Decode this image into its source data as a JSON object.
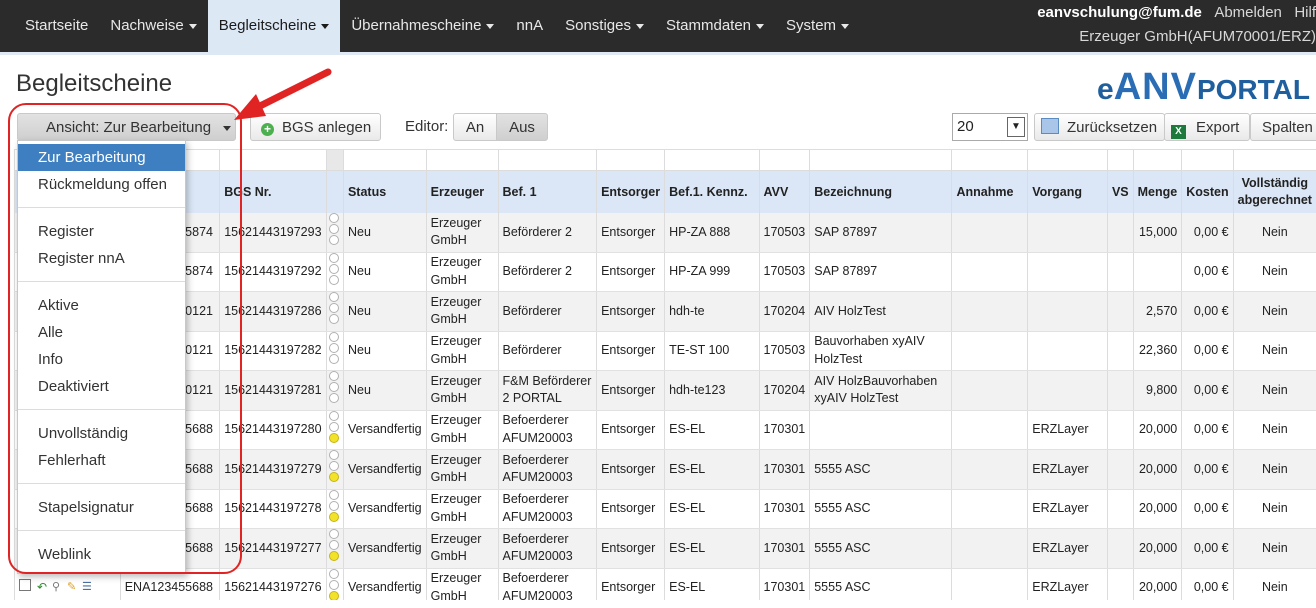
{
  "nav": {
    "items": [
      {
        "label": "Startseite",
        "caret": false,
        "active": false
      },
      {
        "label": "Nachweise",
        "caret": true,
        "active": false
      },
      {
        "label": "Begleitscheine",
        "caret": true,
        "active": true
      },
      {
        "label": "Übernahmescheine",
        "caret": true,
        "active": false
      },
      {
        "label": "nnA",
        "caret": false,
        "active": false
      },
      {
        "label": "Sonstiges",
        "caret": true,
        "active": false
      },
      {
        "label": "Stammdaten",
        "caret": true,
        "active": false
      },
      {
        "label": "System",
        "caret": true,
        "active": false
      }
    ],
    "user": "eanvschulung@fum.de",
    "logout": "Abmelden",
    "help": "Hilf",
    "company": "Erzeuger GmbH(AFUM70001/ERZ)"
  },
  "page": {
    "title": "Begleitscheine",
    "logo_e": "e",
    "logo_anv": "ANV",
    "logo_portal": "PORTAL"
  },
  "toolbar": {
    "view_button": "Ansicht: Zur Bearbeitung",
    "create_button": "BGS anlegen",
    "editor_label": "Editor:",
    "editor_on": "An",
    "editor_off": "Aus",
    "page_size": "20",
    "reset_button": "Zurücksetzen",
    "export_button": "Export",
    "columns_button": "Spalten"
  },
  "dropdown": {
    "groups": [
      [
        "Zur Bearbeitung",
        "Rückmeldung offen"
      ],
      [
        "Register",
        "Register nnA"
      ],
      [
        "Aktive",
        "Alle",
        "Info",
        "Deaktiviert"
      ],
      [
        "Unvollständig",
        "Fehlerhaft"
      ],
      [
        "Stapelsignatur"
      ],
      [
        "Weblink"
      ]
    ],
    "selected": "Zur Bearbeitung"
  },
  "table": {
    "headers": [
      "",
      "Nr.",
      "BGS Nr.",
      "",
      "Status",
      "Erzeuger",
      "Bef. 1",
      "Entsorger",
      "Bef.1. Kennz.",
      "AVV",
      "Bezeichnung",
      "Annahme",
      "Vorgang",
      "VS",
      "Menge",
      "Kosten",
      "Vollständig abgerechnet"
    ],
    "rows": [
      {
        "nr": "ENA123475874",
        "bgs": "15621443197293",
        "light": "none",
        "status": "Neu",
        "erzeuger": "Erzeuger GmbH",
        "bef1": "Beförderer 2",
        "entsorger": "Entsorger",
        "kennz": "HP-ZA 888",
        "avv": "170503",
        "bez": "SAP 87897",
        "annahme": "",
        "vorgang": "",
        "vs": "",
        "menge": "15,000",
        "kosten": "0,00 €",
        "voll": "Nein"
      },
      {
        "nr": "ENA123475874",
        "bgs": "15621443197292",
        "light": "none",
        "status": "Neu",
        "erzeuger": "Erzeuger GmbH",
        "bef1": "Beförderer 2",
        "entsorger": "Entsorger",
        "kennz": "HP-ZA 999",
        "avv": "170503",
        "bez": "SAP 87897",
        "annahme": "",
        "vorgang": "",
        "vs": "",
        "menge": "",
        "kosten": "0,00 €",
        "voll": "Nein"
      },
      {
        "nr": "ENA123420121",
        "bgs": "15621443197286",
        "light": "none",
        "status": "Neu",
        "erzeuger": "Erzeuger GmbH",
        "bef1": "Beförderer",
        "entsorger": "Entsorger",
        "kennz": "hdh-te",
        "avv": "170204",
        "bez": "AIV HolzTest",
        "annahme": "",
        "vorgang": "",
        "vs": "",
        "menge": "2,570",
        "kosten": "0,00 €",
        "voll": "Nein"
      },
      {
        "nr": "ENA123420121",
        "bgs": "15621443197282",
        "light": "none",
        "status": "Neu",
        "erzeuger": "Erzeuger GmbH",
        "bef1": "Beförderer",
        "entsorger": "Entsorger",
        "kennz": "TE-ST 100",
        "avv": "170503",
        "bez": "Bauvorhaben xyAIV HolzTest",
        "annahme": "",
        "vorgang": "",
        "vs": "",
        "menge": "22,360",
        "kosten": "0,00 €",
        "voll": "Nein"
      },
      {
        "nr": "ENA123420121",
        "bgs": "15621443197281",
        "light": "none",
        "status": "Neu",
        "erzeuger": "Erzeuger GmbH",
        "bef1": "F&M Beförderer 2 PORTAL",
        "entsorger": "Entsorger",
        "kennz": "hdh-te123",
        "avv": "170204",
        "bez": "AIV HolzBauvorhaben xyAIV HolzTest",
        "annahme": "",
        "vorgang": "",
        "vs": "",
        "menge": "9,800",
        "kosten": "0,00 €",
        "voll": "Nein"
      },
      {
        "nr": "ENA123455688",
        "bgs": "15621443197280",
        "light": "yellow",
        "status": "Versandfertig",
        "erzeuger": "Erzeuger GmbH",
        "bef1": "Befoerderer AFUM20003",
        "entsorger": "Entsorger",
        "kennz": "ES-EL",
        "avv": "170301",
        "bez": "",
        "annahme": "",
        "vorgang": "ERZLayer",
        "vs": "",
        "menge": "20,000",
        "kosten": "0,00 €",
        "voll": "Nein"
      },
      {
        "nr": "ENA123455688",
        "bgs": "15621443197279",
        "light": "yellow",
        "status": "Versandfertig",
        "erzeuger": "Erzeuger GmbH",
        "bef1": "Befoerderer AFUM20003",
        "entsorger": "Entsorger",
        "kennz": "ES-EL",
        "avv": "170301",
        "bez": "5555 ASC",
        "annahme": "",
        "vorgang": "ERZLayer",
        "vs": "",
        "menge": "20,000",
        "kosten": "0,00 €",
        "voll": "Nein"
      },
      {
        "nr": "ENA123455688",
        "bgs": "15621443197278",
        "light": "yellow",
        "status": "Versandfertig",
        "erzeuger": "Erzeuger GmbH",
        "bef1": "Befoerderer AFUM20003",
        "entsorger": "Entsorger",
        "kennz": "ES-EL",
        "avv": "170301",
        "bez": "5555 ASC",
        "annahme": "",
        "vorgang": "ERZLayer",
        "vs": "",
        "menge": "20,000",
        "kosten": "0,00 €",
        "voll": "Nein"
      },
      {
        "nr": "ENA123455688",
        "bgs": "15621443197277",
        "light": "yellow",
        "status": "Versandfertig",
        "erzeuger": "Erzeuger GmbH",
        "bef1": "Befoerderer AFUM20003",
        "entsorger": "Entsorger",
        "kennz": "ES-EL",
        "avv": "170301",
        "bez": "5555 ASC",
        "annahme": "",
        "vorgang": "ERZLayer",
        "vs": "",
        "menge": "20,000",
        "kosten": "0,00 €",
        "voll": "Nein"
      },
      {
        "nr": "ENA123455688",
        "bgs": "15621443197276",
        "light": "yellow",
        "status": "Versandfertig",
        "erzeuger": "Erzeuger GmbH",
        "bef1": "Befoerderer AFUM20003",
        "entsorger": "Entsorger",
        "kennz": "ES-EL",
        "avv": "170301",
        "bez": "5555 ASC",
        "annahme": "",
        "vorgang": "ERZLayer",
        "vs": "",
        "menge": "20,000",
        "kosten": "0,00 €",
        "voll": "Nein"
      }
    ]
  },
  "colors": {
    "navbar": "#2b2b2b",
    "nav_active": "#dde8f5",
    "header_row": "#dbe7f6",
    "selected_item": "#3d7fc1",
    "annotation": "#e02424",
    "logo": "#1f5f9e",
    "status_light_yellow": "#f2e32a"
  }
}
